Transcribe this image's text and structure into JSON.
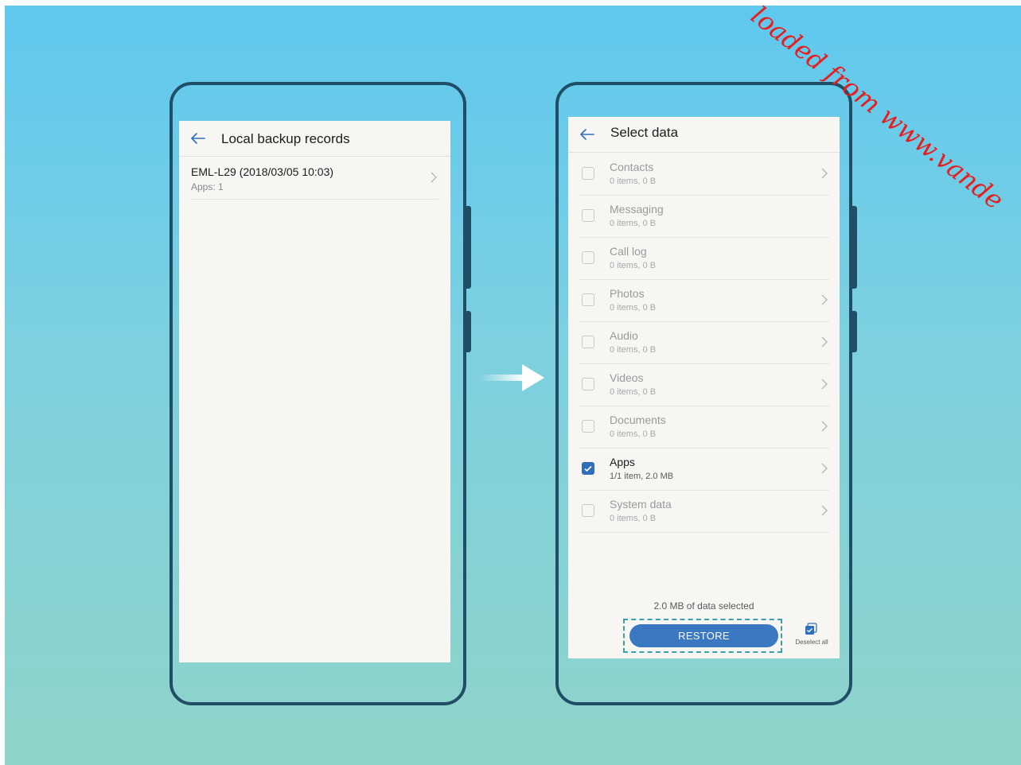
{
  "left_screen": {
    "title": "Local backup records",
    "record": {
      "name": "EML-L29 (2018/03/05 10:03)",
      "detail": "Apps: 1"
    }
  },
  "right_screen": {
    "title": "Select data",
    "items": [
      {
        "name": "Contacts",
        "detail": "0 items, 0 B",
        "checked": false,
        "has_chevron": true
      },
      {
        "name": "Messaging",
        "detail": "0 items, 0 B",
        "checked": false,
        "has_chevron": false
      },
      {
        "name": "Call log",
        "detail": "0 items, 0 B",
        "checked": false,
        "has_chevron": false
      },
      {
        "name": "Photos",
        "detail": "0 items, 0 B",
        "checked": false,
        "has_chevron": true
      },
      {
        "name": "Audio",
        "detail": "0 items, 0 B",
        "checked": false,
        "has_chevron": true
      },
      {
        "name": "Videos",
        "detail": "0 items, 0 B",
        "checked": false,
        "has_chevron": true
      },
      {
        "name": "Documents",
        "detail": "0 items, 0 B",
        "checked": false,
        "has_chevron": true
      },
      {
        "name": "Apps",
        "detail": "1/1 item, 2.0 MB",
        "checked": true,
        "has_chevron": true
      },
      {
        "name": "System data",
        "detail": "0 items, 0 B",
        "checked": false,
        "has_chevron": true
      }
    ],
    "selection_info": "2.0 MB of data selected",
    "restore_label": "RESTORE",
    "deselect_label": "Deselect all"
  },
  "watermark": "loaded from www.vande",
  "colors": {
    "accent": "#2f6fbb",
    "button": "#3a78c2",
    "phone_frame": "#1f4e66",
    "highlight": "#3aa0a8",
    "watermark": "#e61e1e"
  }
}
